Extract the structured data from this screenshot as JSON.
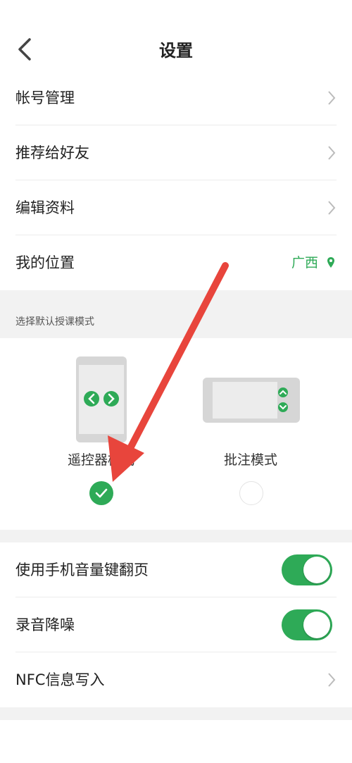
{
  "header": {
    "title": "设置"
  },
  "menu": [
    {
      "label": "帐号管理"
    },
    {
      "label": "推荐给好友"
    },
    {
      "label": "编辑资料"
    }
  ],
  "location": {
    "label": "我的位置",
    "value": "广西"
  },
  "teaching_mode": {
    "section_title": "选择默认授课模式",
    "options": [
      {
        "label": "遥控器模式",
        "selected": true
      },
      {
        "label": "批注模式",
        "selected": false
      }
    ]
  },
  "settings": [
    {
      "label": "使用手机音量键翻页",
      "enabled": true
    },
    {
      "label": "录音降噪",
      "enabled": true
    },
    {
      "label": "NFC信息写入"
    }
  ],
  "colors": {
    "accent": "#2eaa57",
    "arrow": "#e8453c",
    "section_bg": "#f2f2f2"
  }
}
